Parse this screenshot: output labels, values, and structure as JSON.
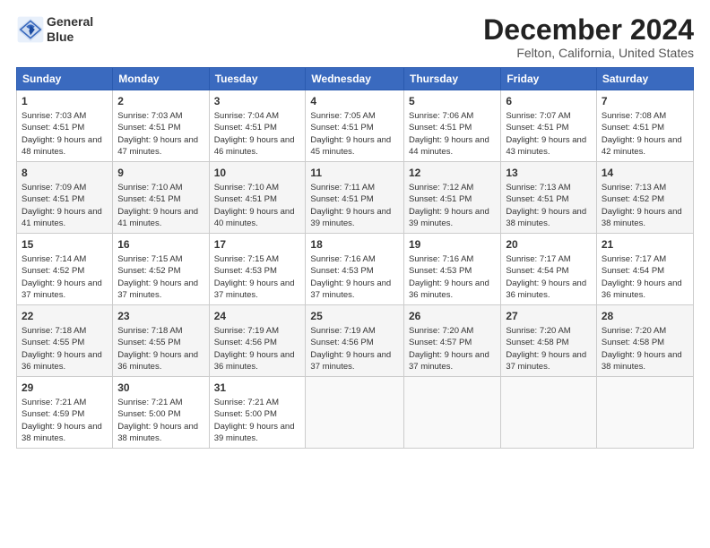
{
  "logo": {
    "line1": "General",
    "line2": "Blue"
  },
  "title": "December 2024",
  "subtitle": "Felton, California, United States",
  "weekdays": [
    "Sunday",
    "Monday",
    "Tuesday",
    "Wednesday",
    "Thursday",
    "Friday",
    "Saturday"
  ],
  "weeks": [
    [
      {
        "day": "1",
        "sunrise": "7:03 AM",
        "sunset": "4:51 PM",
        "daylight": "9 hours and 48 minutes."
      },
      {
        "day": "2",
        "sunrise": "7:03 AM",
        "sunset": "4:51 PM",
        "daylight": "9 hours and 47 minutes."
      },
      {
        "day": "3",
        "sunrise": "7:04 AM",
        "sunset": "4:51 PM",
        "daylight": "9 hours and 46 minutes."
      },
      {
        "day": "4",
        "sunrise": "7:05 AM",
        "sunset": "4:51 PM",
        "daylight": "9 hours and 45 minutes."
      },
      {
        "day": "5",
        "sunrise": "7:06 AM",
        "sunset": "4:51 PM",
        "daylight": "9 hours and 44 minutes."
      },
      {
        "day": "6",
        "sunrise": "7:07 AM",
        "sunset": "4:51 PM",
        "daylight": "9 hours and 43 minutes."
      },
      {
        "day": "7",
        "sunrise": "7:08 AM",
        "sunset": "4:51 PM",
        "daylight": "9 hours and 42 minutes."
      }
    ],
    [
      {
        "day": "8",
        "sunrise": "7:09 AM",
        "sunset": "4:51 PM",
        "daylight": "9 hours and 41 minutes."
      },
      {
        "day": "9",
        "sunrise": "7:10 AM",
        "sunset": "4:51 PM",
        "daylight": "9 hours and 41 minutes."
      },
      {
        "day": "10",
        "sunrise": "7:10 AM",
        "sunset": "4:51 PM",
        "daylight": "9 hours and 40 minutes."
      },
      {
        "day": "11",
        "sunrise": "7:11 AM",
        "sunset": "4:51 PM",
        "daylight": "9 hours and 39 minutes."
      },
      {
        "day": "12",
        "sunrise": "7:12 AM",
        "sunset": "4:51 PM",
        "daylight": "9 hours and 39 minutes."
      },
      {
        "day": "13",
        "sunrise": "7:13 AM",
        "sunset": "4:51 PM",
        "daylight": "9 hours and 38 minutes."
      },
      {
        "day": "14",
        "sunrise": "7:13 AM",
        "sunset": "4:52 PM",
        "daylight": "9 hours and 38 minutes."
      }
    ],
    [
      {
        "day": "15",
        "sunrise": "7:14 AM",
        "sunset": "4:52 PM",
        "daylight": "9 hours and 37 minutes."
      },
      {
        "day": "16",
        "sunrise": "7:15 AM",
        "sunset": "4:52 PM",
        "daylight": "9 hours and 37 minutes."
      },
      {
        "day": "17",
        "sunrise": "7:15 AM",
        "sunset": "4:53 PM",
        "daylight": "9 hours and 37 minutes."
      },
      {
        "day": "18",
        "sunrise": "7:16 AM",
        "sunset": "4:53 PM",
        "daylight": "9 hours and 37 minutes."
      },
      {
        "day": "19",
        "sunrise": "7:16 AM",
        "sunset": "4:53 PM",
        "daylight": "9 hours and 36 minutes."
      },
      {
        "day": "20",
        "sunrise": "7:17 AM",
        "sunset": "4:54 PM",
        "daylight": "9 hours and 36 minutes."
      },
      {
        "day": "21",
        "sunrise": "7:17 AM",
        "sunset": "4:54 PM",
        "daylight": "9 hours and 36 minutes."
      }
    ],
    [
      {
        "day": "22",
        "sunrise": "7:18 AM",
        "sunset": "4:55 PM",
        "daylight": "9 hours and 36 minutes."
      },
      {
        "day": "23",
        "sunrise": "7:18 AM",
        "sunset": "4:55 PM",
        "daylight": "9 hours and 36 minutes."
      },
      {
        "day": "24",
        "sunrise": "7:19 AM",
        "sunset": "4:56 PM",
        "daylight": "9 hours and 36 minutes."
      },
      {
        "day": "25",
        "sunrise": "7:19 AM",
        "sunset": "4:56 PM",
        "daylight": "9 hours and 37 minutes."
      },
      {
        "day": "26",
        "sunrise": "7:20 AM",
        "sunset": "4:57 PM",
        "daylight": "9 hours and 37 minutes."
      },
      {
        "day": "27",
        "sunrise": "7:20 AM",
        "sunset": "4:58 PM",
        "daylight": "9 hours and 37 minutes."
      },
      {
        "day": "28",
        "sunrise": "7:20 AM",
        "sunset": "4:58 PM",
        "daylight": "9 hours and 38 minutes."
      }
    ],
    [
      {
        "day": "29",
        "sunrise": "7:21 AM",
        "sunset": "4:59 PM",
        "daylight": "9 hours and 38 minutes."
      },
      {
        "day": "30",
        "sunrise": "7:21 AM",
        "sunset": "5:00 PM",
        "daylight": "9 hours and 38 minutes."
      },
      {
        "day": "31",
        "sunrise": "7:21 AM",
        "sunset": "5:00 PM",
        "daylight": "9 hours and 39 minutes."
      },
      null,
      null,
      null,
      null
    ]
  ]
}
